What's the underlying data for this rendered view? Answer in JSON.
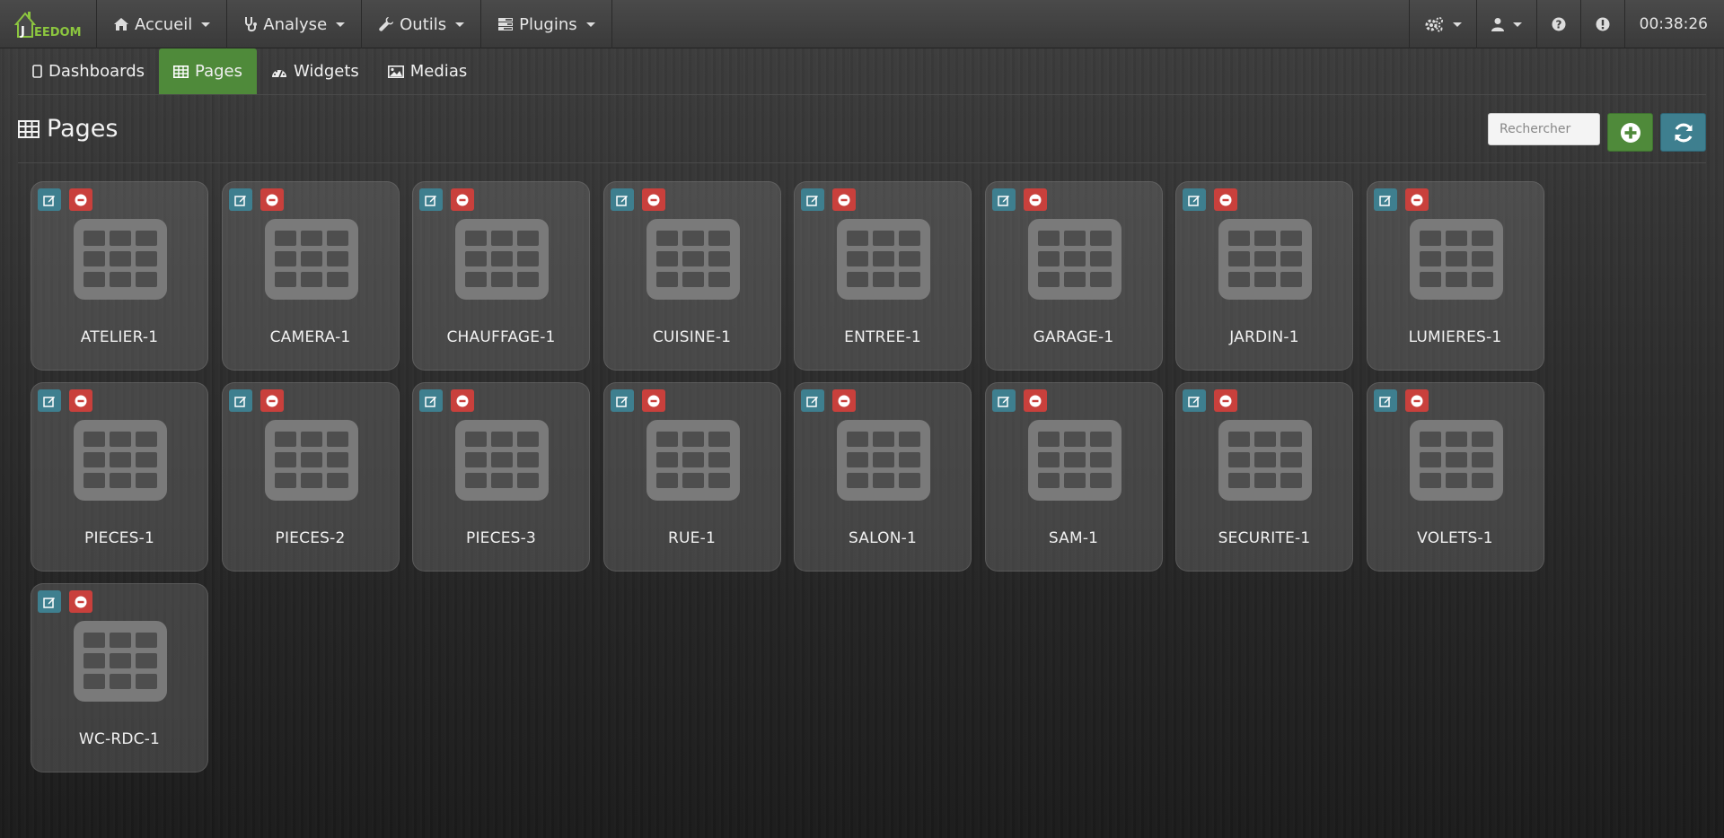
{
  "navbar": {
    "brand": {
      "text": "EEDOM",
      "prefix": "J"
    },
    "menus": [
      {
        "label": "Accueil",
        "icon": "home-icon"
      },
      {
        "label": "Analyse",
        "icon": "stethoscope-icon"
      },
      {
        "label": "Outils",
        "icon": "wrench-icon"
      },
      {
        "label": "Plugins",
        "icon": "tasks-icon"
      }
    ],
    "right_icons": [
      "cogs-icon",
      "user-icon",
      "question-icon",
      "exclamation-icon"
    ],
    "clock": "00:38:26"
  },
  "subnav": {
    "tabs": [
      {
        "label": "Dashboards",
        "icon": "tablet-icon",
        "active": false
      },
      {
        "label": "Pages",
        "icon": "table-icon",
        "active": true
      },
      {
        "label": "Widgets",
        "icon": "dashboard-icon",
        "active": false
      },
      {
        "label": "Medias",
        "icon": "image-icon",
        "active": false
      }
    ]
  },
  "header": {
    "title": "Pages",
    "search_placeholder": "Rechercher"
  },
  "pages": [
    "ATELIER-1",
    "CAMERA-1",
    "CHAUFFAGE-1",
    "CUISINE-1",
    "ENTREE-1",
    "GARAGE-1",
    "JARDIN-1",
    "LUMIERES-1",
    "PIECES-1",
    "PIECES-2",
    "PIECES-3",
    "RUE-1",
    "SALON-1",
    "SAM-1",
    "SECURITE-1",
    "VOLETS-1",
    "WC-RDC-1"
  ],
  "colors": {
    "accent_green": "#4f8a3a",
    "edit_blue": "#3e7f8f",
    "delete_red": "#c9403c",
    "brand_green": "#8cc63f"
  }
}
